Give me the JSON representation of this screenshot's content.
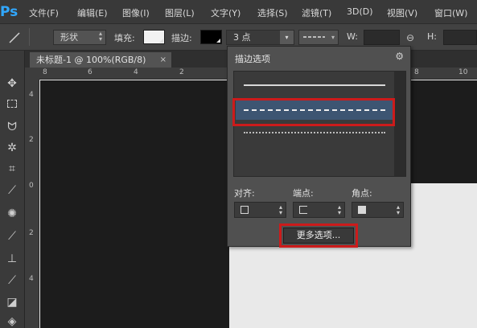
{
  "app": {
    "logo": "Ps"
  },
  "menu": [
    "文件(F)",
    "编辑(E)",
    "图像(I)",
    "图层(L)",
    "文字(Y)",
    "选择(S)",
    "滤镜(T)",
    "3D(D)",
    "视图(V)",
    "窗口(W)"
  ],
  "options_bar": {
    "mode_value": "形状",
    "fill_label": "填充:",
    "fill_color": "#f2f2f2",
    "stroke_label": "描边:",
    "stroke_color": "#000000",
    "stroke_width_value": "3 点",
    "width_label": "W:",
    "height_label": "H:"
  },
  "document": {
    "tab_title": "未标题-1 @ 100%(RGB/8)",
    "tab_close": "×"
  },
  "rulers": {
    "top_ticks": [
      "8",
      "6",
      "4",
      "2",
      "8",
      "10"
    ],
    "left_ticks": [
      "4",
      "2",
      "0",
      "2",
      "4"
    ]
  },
  "stroke_panel": {
    "title": "描边选项",
    "styles": [
      "solid",
      "dashed",
      "dotted"
    ],
    "selected_style": "dashed",
    "align_label": "对齐:",
    "caps_label": "端点:",
    "corners_label": "角点:",
    "more_button": "更多选项..."
  },
  "colors": {
    "highlight": "#cc1b1b",
    "selected_row": "#3d5572",
    "ps_blue": "#31a8ff"
  },
  "tools": [
    "move-tool",
    "marquee-tool",
    "lasso-tool",
    "magic-wand-tool",
    "crop-tool",
    "eyedropper-tool",
    "healing-tool",
    "brush-tool",
    "stamp-tool",
    "history-brush-tool",
    "eraser-tool",
    "fill-tool"
  ]
}
